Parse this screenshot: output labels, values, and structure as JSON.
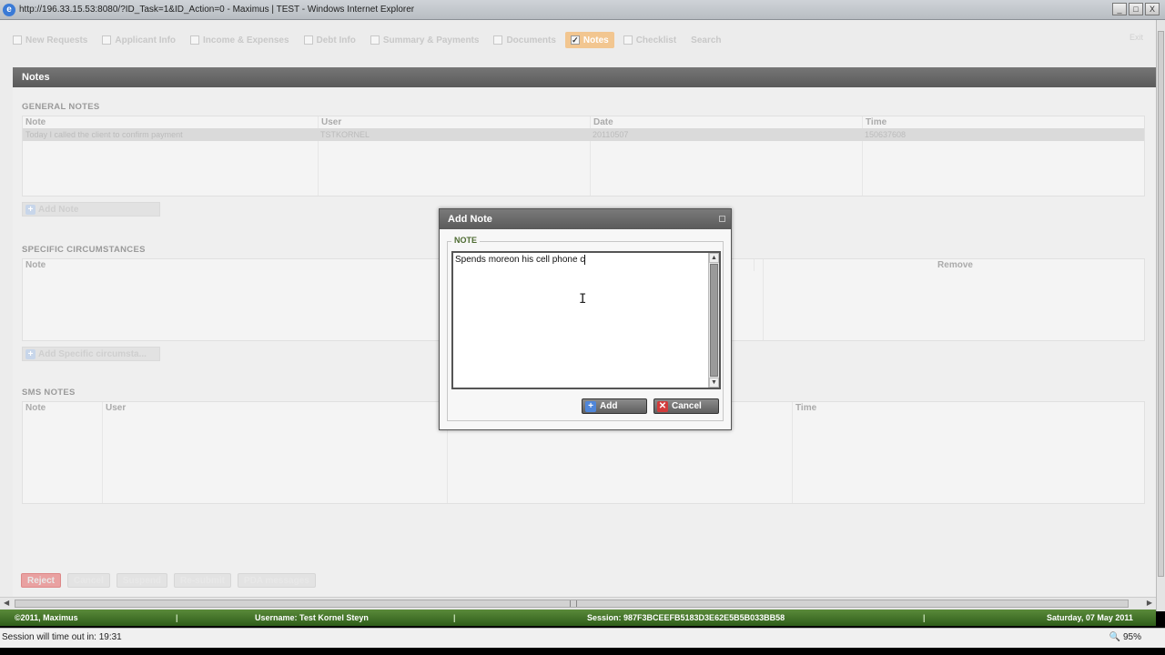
{
  "window": {
    "title": "http://196.33.15.53:8080/?ID_Task=1&ID_Action=0 - Maximus | TEST - Windows Internet Explorer",
    "min": "_",
    "max": "□",
    "close": "X"
  },
  "tabs": [
    {
      "label": "New Requests",
      "checked": false
    },
    {
      "label": "Applicant Info",
      "checked": false
    },
    {
      "label": "Income & Expenses",
      "checked": false
    },
    {
      "label": "Debt Info",
      "checked": false
    },
    {
      "label": "Summary & Payments",
      "checked": false
    },
    {
      "label": "Documents",
      "checked": false
    },
    {
      "label": "Notes",
      "checked": true,
      "active": true
    },
    {
      "label": "Checklist",
      "checked": false
    },
    {
      "label": "Search",
      "checked": false
    }
  ],
  "tab_check_mark": "✓",
  "tab_right": "Exit",
  "panel": {
    "title": "Notes",
    "general": {
      "title": "GENERAL NOTES",
      "columns": [
        "Note",
        "User",
        "Date",
        "Time"
      ],
      "rows": [
        [
          "Today I called the client to confirm payment",
          "TSTKORNEL",
          "20110507",
          "150637608"
        ]
      ],
      "button": "Add Note"
    },
    "specific": {
      "title": "SPECIFIC CIRCUMSTANCES",
      "columns": [
        "Note",
        "",
        "Remove"
      ],
      "button": "Add Specific circumsta..."
    },
    "sms": {
      "title": "SMS NOTES",
      "columns": [
        "Note",
        "User",
        "",
        "Time"
      ]
    }
  },
  "actions": [
    "Reject",
    "Cancel",
    "Suspend",
    "Re-submit",
    "PDA messages"
  ],
  "status": {
    "copyright": "©2011, Maximus",
    "username": "Username: Test Kornel Steyn",
    "session": "Session: 987F3BCEEFB5183D3E62E5B5B033BB58",
    "date": "Saturday, 07 May 2011",
    "separator": "|"
  },
  "ie_status": {
    "timeout": "Session will time out in:  19:31",
    "zoom": "95%"
  },
  "modal": {
    "title": "Add Note",
    "legend": "NOTE",
    "text": "Spends moreon his cell phone c",
    "add": "Add",
    "cancel": "Cancel",
    "plus_glyph": "+",
    "x_glyph": "✕"
  },
  "colors": {
    "active_tab": "#f2c690",
    "status_green": "#3f6e26",
    "legend_green": "#4c6a30",
    "reject": "#e9a1a1"
  }
}
